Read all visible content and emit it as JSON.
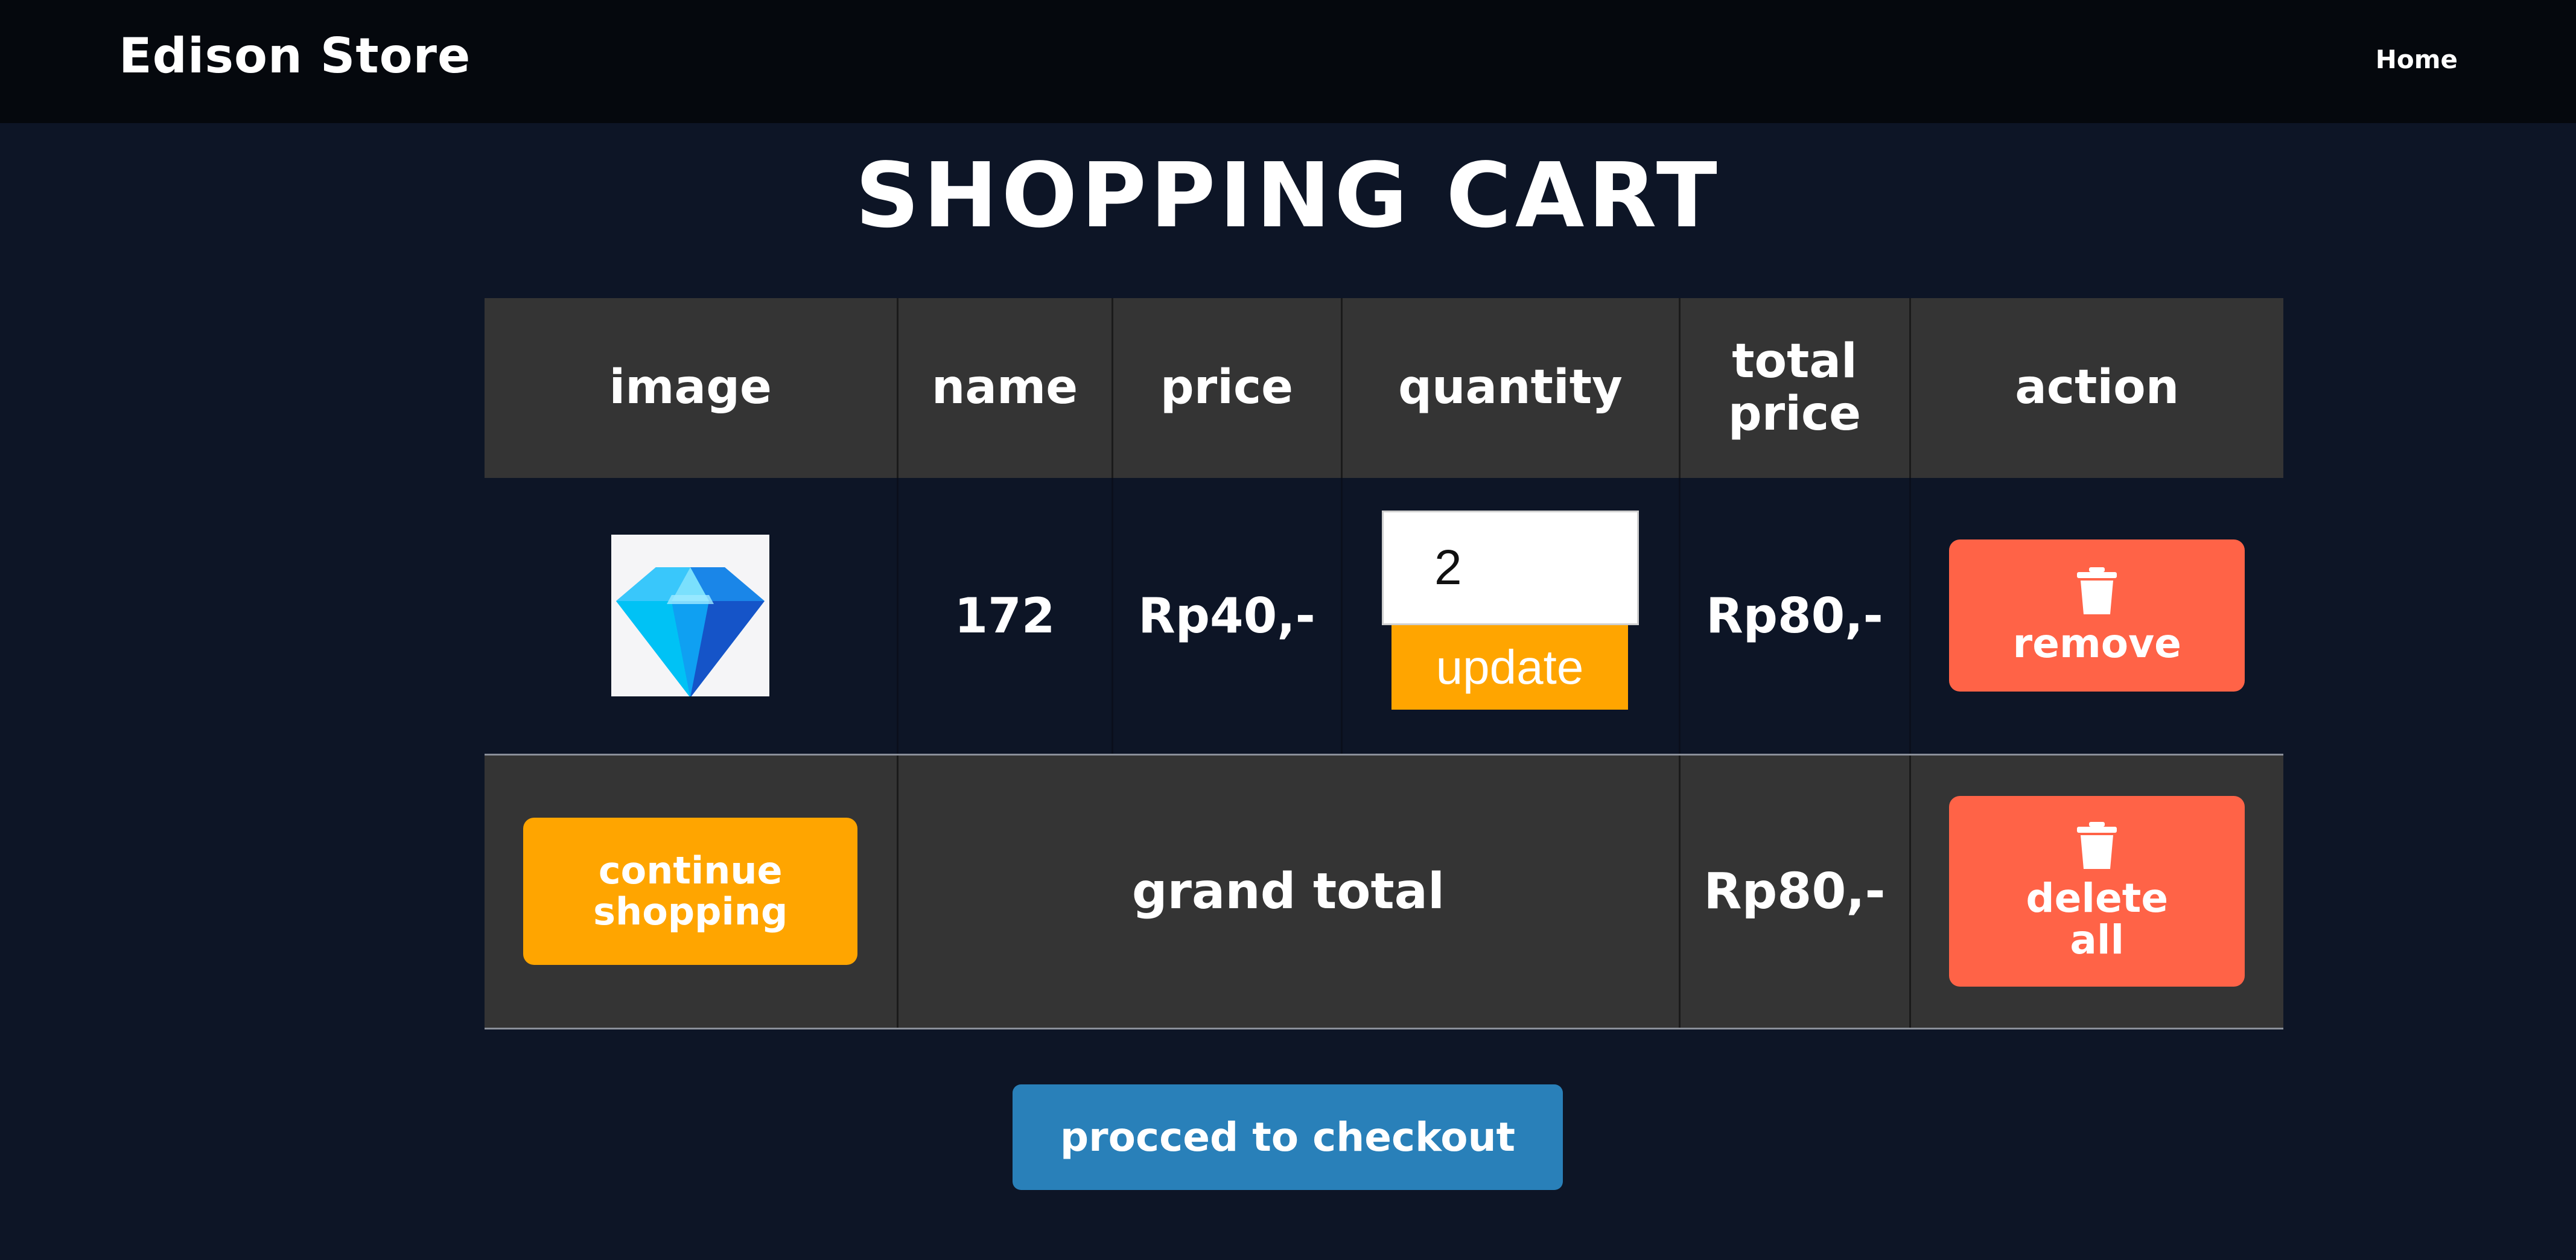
{
  "navbar": {
    "brand": "Edison Store",
    "home_link": "Home"
  },
  "page": {
    "title": "SHOPPING CART"
  },
  "table": {
    "headers": {
      "image": "image",
      "name": "name",
      "price": "price",
      "quantity": "quantity",
      "total_price": "total price",
      "action": "action"
    },
    "items": [
      {
        "image_icon": "diamond-icon",
        "name": "172",
        "price": "Rp40,-",
        "quantity": "2",
        "update_label": "update",
        "total_price": "Rp80,-",
        "remove_label": "remove"
      }
    ],
    "footer": {
      "continue_label": "continue shopping",
      "grand_total_label": "grand total",
      "grand_total_value": "Rp80,-",
      "delete_all_label": "delete all"
    }
  },
  "checkout": {
    "label": "procced to checkout"
  },
  "colors": {
    "background": "#0d1526",
    "navbar": "#05080d",
    "table_header": "#343434",
    "orange_button": "#ffa500",
    "red_button": "#ff6347",
    "checkout_button": "#2980b9"
  }
}
